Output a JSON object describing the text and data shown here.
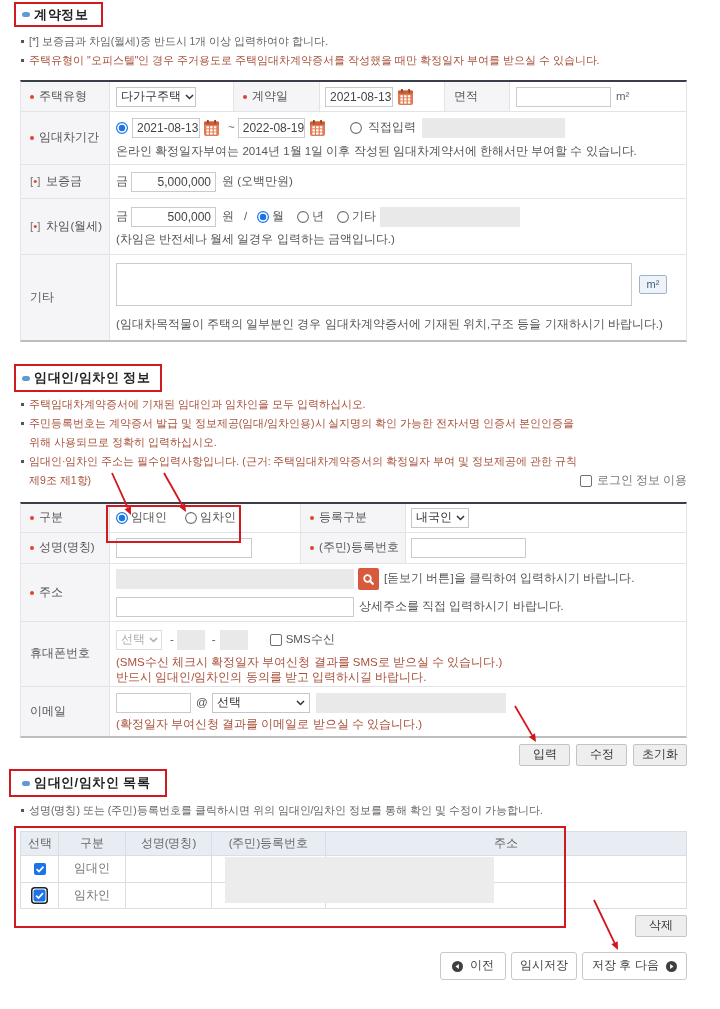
{
  "contract_section": {
    "title": "계약정보",
    "highlighted": true,
    "notes": [
      {
        "kind": "info",
        "text": "[*] 보증금과 차임(월세)중 반드시 1개 이상 입력하여야 합니다."
      },
      {
        "kind": "warning",
        "text": "주택유형이 \"오피스텔\"인 경우 주거용도로 주택임대차계약증서를 작성했을 때만 확정일자 부여를 받으실 수 있습니다."
      }
    ],
    "housing_type": {
      "label": "주택유형",
      "required": true,
      "value": "다가구주택"
    },
    "contract_date": {
      "label": "계약일",
      "required": true,
      "value": "2021-08-13"
    },
    "area": {
      "label": "면적",
      "unit": "m²"
    },
    "lease_period": {
      "label": "임대차기간",
      "required": true,
      "range": {
        "selected": true,
        "start": "2021-08-13",
        "separator": "~",
        "end": "2022-08-19"
      },
      "manual": {
        "selected": false,
        "label": "직접입력",
        "disabled": true
      },
      "note": "온라인 확정일자부여는 2014년 1월 1일 이후 작성된 임대차계약서에 한해서만 부여할 수 있습니다."
    },
    "deposit": {
      "prefix": "[•]",
      "label": "보증금",
      "currency": "금",
      "value": "5,000,000",
      "unit": "원 (오백만원)"
    },
    "rent": {
      "prefix": "[•]",
      "label": "차임(월세)",
      "currency": "금",
      "value": "500,000",
      "unit": "원",
      "separator": "/",
      "periods": [
        {
          "label": "월",
          "selected": true
        },
        {
          "label": "년",
          "selected": false
        },
        {
          "label": "기타",
          "selected": false
        }
      ],
      "other_field_disabled": true,
      "note": "(차임은 반전세나 월세 일경우 입력하는 금액입니다.)"
    },
    "etc": {
      "label": "기타",
      "button": "m²",
      "note": "(임대차목적물이 주택의 일부분인 경우 임대차계약증서에 기재된 위치,구조 등을 기재하시기 바랍니다.)"
    }
  },
  "party_section": {
    "title": "임대인/임차인 정보",
    "highlighted": true,
    "notes": [
      {
        "kind": "warning",
        "text": "주택임대차계약증서에 기재된 임대인과 임차인을 모두 입력하십시오."
      },
      {
        "kind": "warning",
        "text": "주민등록번호는 계약증서 발급 및 정보제공(임대/임차인용)시 실지명의 확인 가능한 전자서명 인증서 본인인증을 위해 사용되므로 정확히 입력하십시오."
      },
      {
        "kind": "warning",
        "text": "임대인·임차인 주소는 필수입력사항입니다. (근거: 주택임대차계약증서의 확정일자 부여 및 정보제공에 관한 규칙 제9조 제1항)"
      }
    ],
    "use_login_info": {
      "label": "로그인 정보 이용",
      "checked": false
    },
    "role": {
      "label": "구분",
      "required": true,
      "highlighted": true,
      "options": [
        {
          "label": "임대인",
          "selected": true,
          "arrow": true
        },
        {
          "label": "임차인",
          "selected": false,
          "arrow": true
        }
      ]
    },
    "registration_type": {
      "label": "등록구분",
      "required": true,
      "value": "내국인"
    },
    "name": {
      "label": "성명(명칭)",
      "required": true
    },
    "resident_number": {
      "label": "(주민)등록번호",
      "required": true
    },
    "address": {
      "label": "주소",
      "required": true,
      "disabled": true,
      "hint": "[돋보기 버튼]을 클릭하여 입력하시기 바랍니다.",
      "detail_hint": "상세주소를 직접 입력하시기 바랍니다."
    },
    "mobile": {
      "label": "휴대폰번호",
      "disabled": true,
      "carrier": "선택",
      "dashes": [
        "-",
        "-"
      ],
      "sms": {
        "label": "SMS수신",
        "checked": false
      },
      "notes": [
        "(SMS수신 체크시 확정일자 부여신청 결과를 SMS로 받으실 수 있습니다.)",
        "반드시 임대인/임차인의 동의를 받고 입력하시길 바랍니다."
      ]
    },
    "email": {
      "label": "이메일",
      "at": "@",
      "domain": "선택",
      "domain_field_disabled": true,
      "note": "(확정일자 부여신청 결과를 이메일로 받으실 수 있습니다.)"
    },
    "actions": [
      {
        "label": "입력",
        "arrow": true
      },
      {
        "label": "수정"
      },
      {
        "label": "초기화"
      }
    ]
  },
  "list_section": {
    "title": "임대인/임차인 목록",
    "highlighted": true,
    "notes": [
      {
        "kind": "info",
        "text": "성명(명칭) 또는 (주민)등록번호를 클릭하시면 위의 임대인/임차인 정보를 통해 확인 및 수정이 가능합니다."
      }
    ],
    "table": {
      "highlighted": true,
      "redacted": true,
      "columns": [
        "선택",
        "구분",
        "성명(명칭)",
        "(주민)등록번호",
        "주소"
      ],
      "rows": [
        {
          "checked": true,
          "focused": false,
          "division": "임대인"
        },
        {
          "checked": true,
          "focused": true,
          "division": "임차인"
        }
      ]
    },
    "delete_button": "삭제"
  },
  "navigation": [
    {
      "kind": "back",
      "label": "이전"
    },
    {
      "kind": "plain",
      "label": "임시저장"
    },
    {
      "kind": "forward",
      "label": "저장 후 다음",
      "arrow": true
    }
  ]
}
